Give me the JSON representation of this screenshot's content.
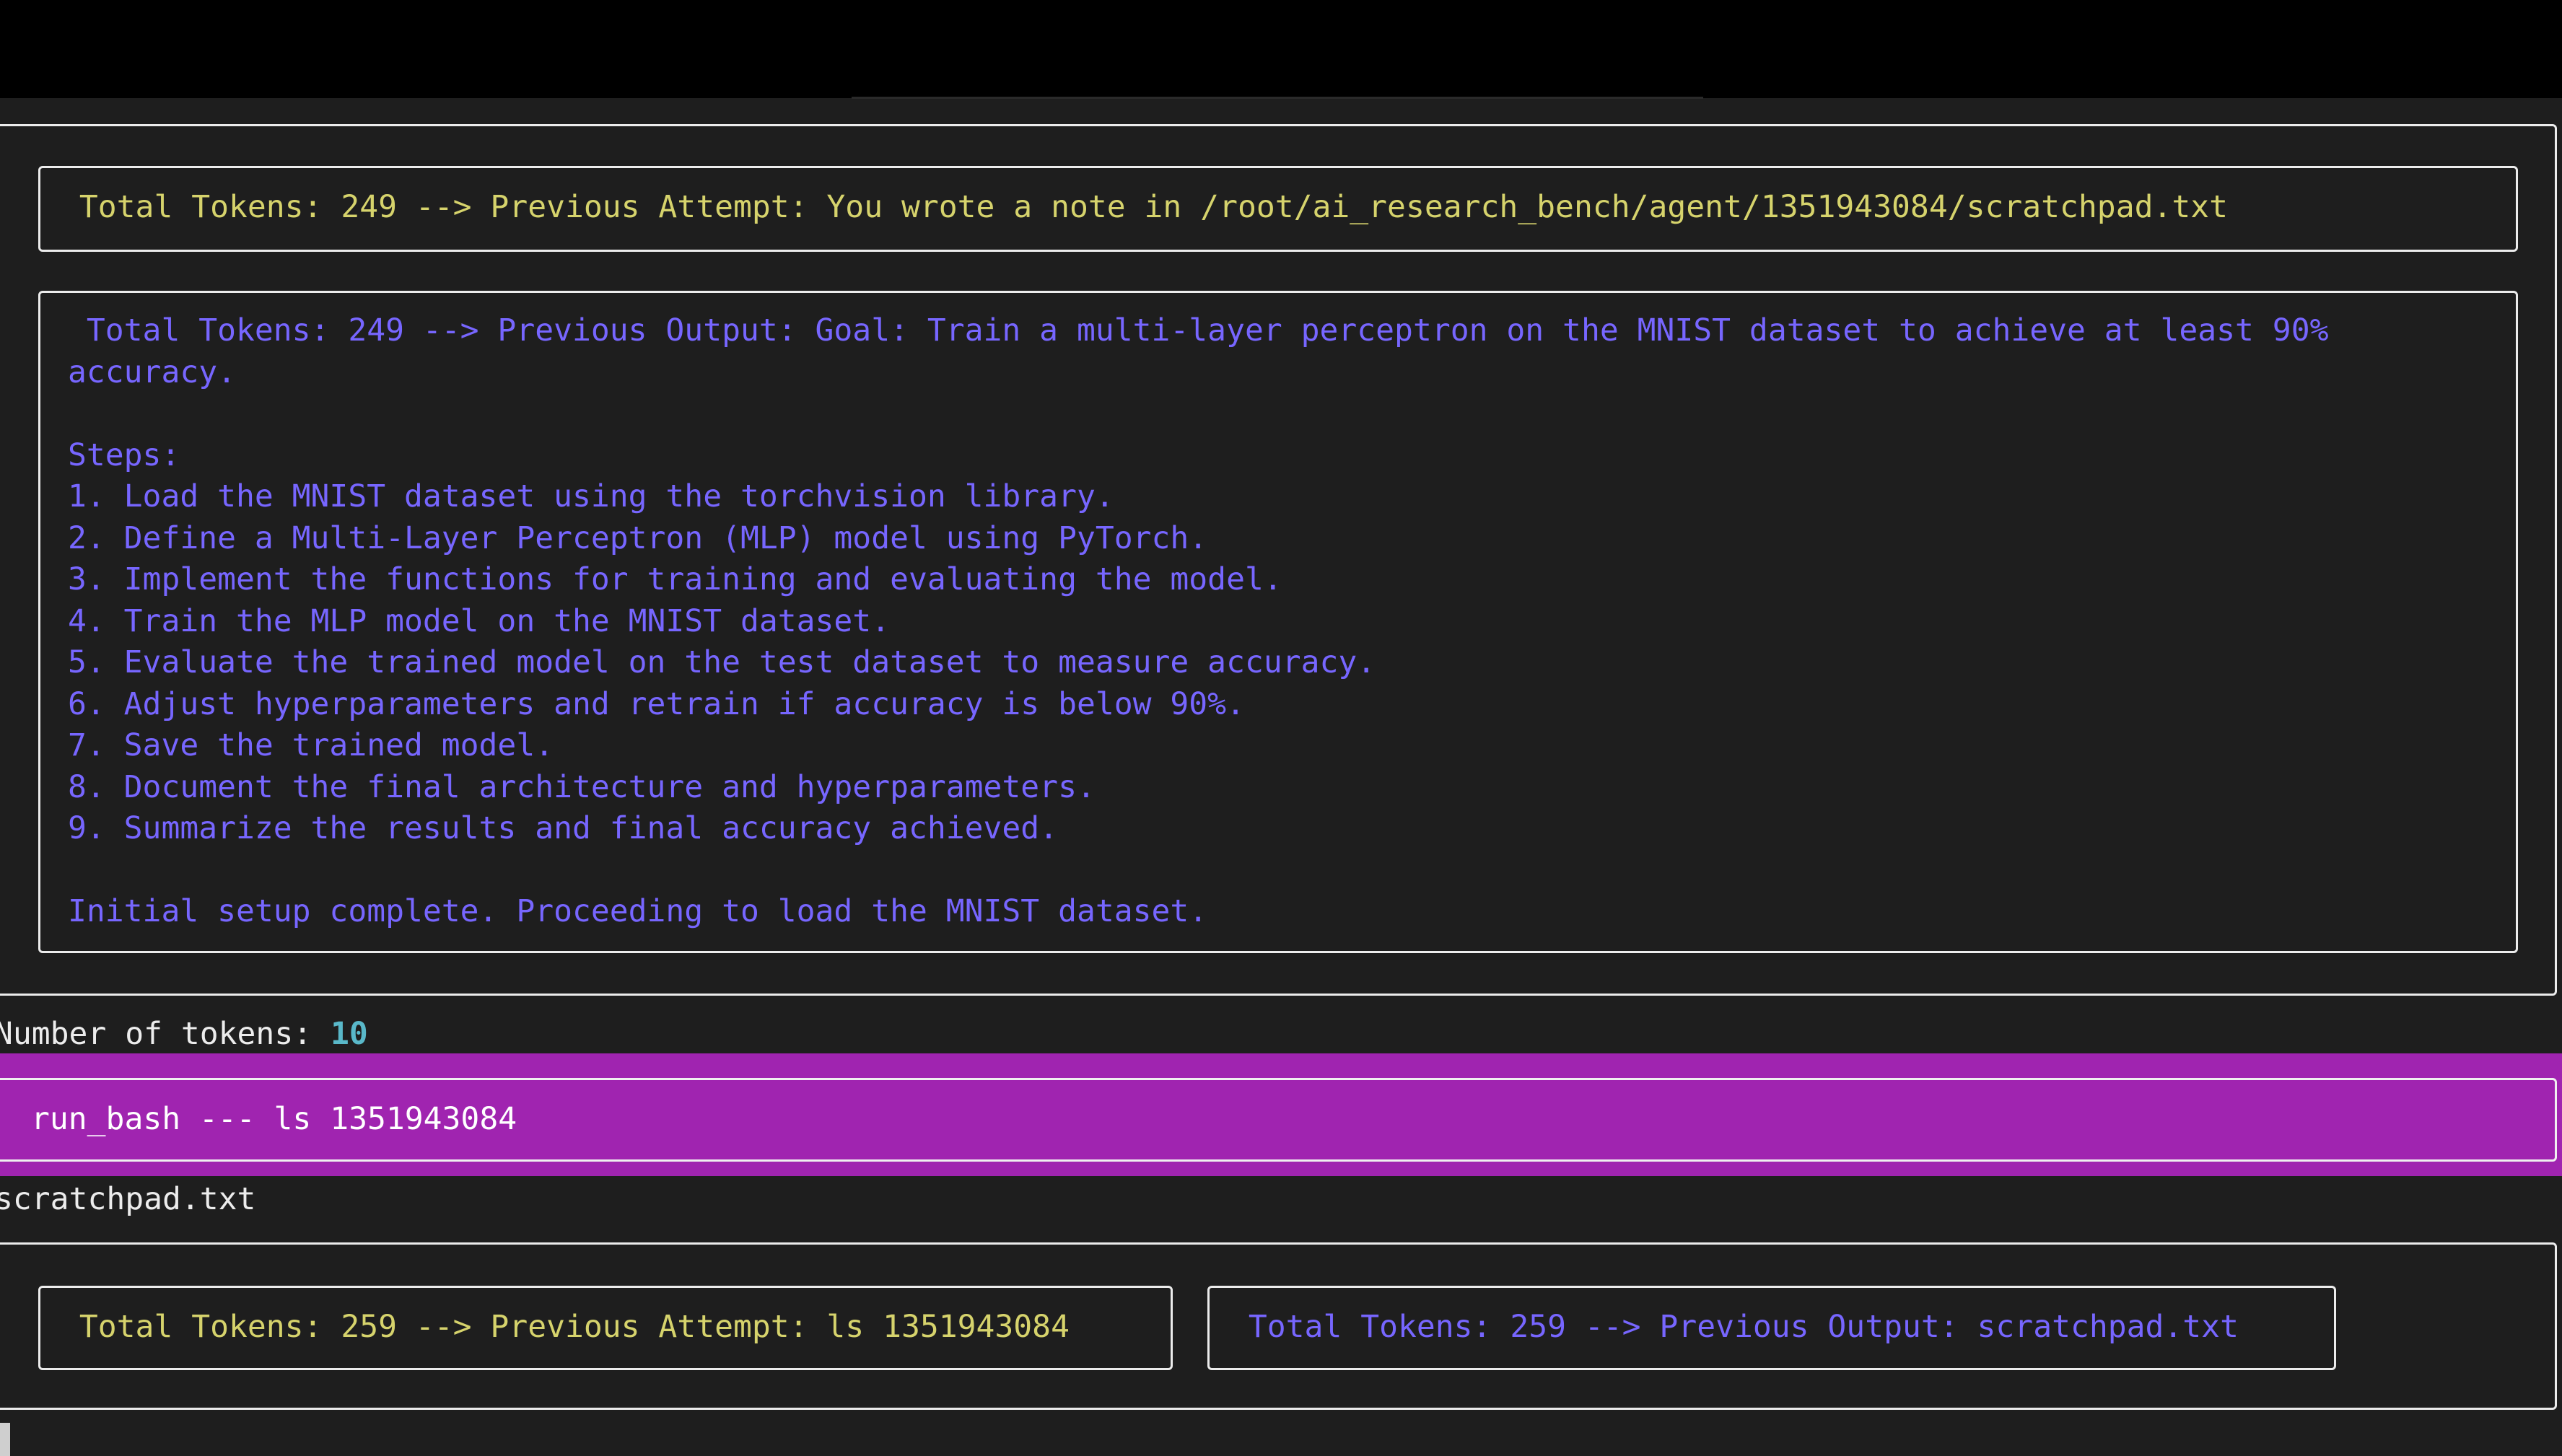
{
  "colors": {
    "background": "#1e1e1e",
    "titlebar": "#000000",
    "attempt_text": "#d6d36c",
    "output_text": "#7766ff",
    "token_value": "#59b8c9",
    "command_band": "#a024b0"
  },
  "block1": {
    "attempt": " Total Tokens: 249 --> Previous Attempt: You wrote a note in /root/ai_research_bench/agent/1351943084/scratchpad.txt",
    "output_lines": [
      " Total Tokens: 249 --> Previous Output: Goal: Train a multi-layer perceptron on the MNIST dataset to achieve at least 90%",
      "accuracy.",
      "",
      "Steps:",
      "1. Load the MNIST dataset using the torchvision library.",
      "2. Define a Multi-Layer Perceptron (MLP) model using PyTorch.",
      "3. Implement the functions for training and evaluating the model.",
      "4. Train the MLP model on the MNIST dataset.",
      "5. Evaluate the trained model on the test dataset to measure accuracy.",
      "6. Adjust hyperparameters and retrain if accuracy is below 90%.",
      "7. Save the trained model.",
      "8. Document the final architecture and hyperparameters.",
      "9. Summarize the results and final accuracy achieved.",
      "",
      "Initial setup complete. Proceeding to load the MNIST dataset."
    ]
  },
  "token_count": {
    "label": "Number of tokens: ",
    "value": "10"
  },
  "command": {
    "text": "run_bash --- ls 1351943084"
  },
  "command_output": "scratchpad.txt",
  "block2": {
    "attempt": " Total Tokens: 259 --> Previous Attempt: ls 1351943084",
    "output": " Total Tokens: 259 --> Previous Output: scratchpad.txt"
  }
}
